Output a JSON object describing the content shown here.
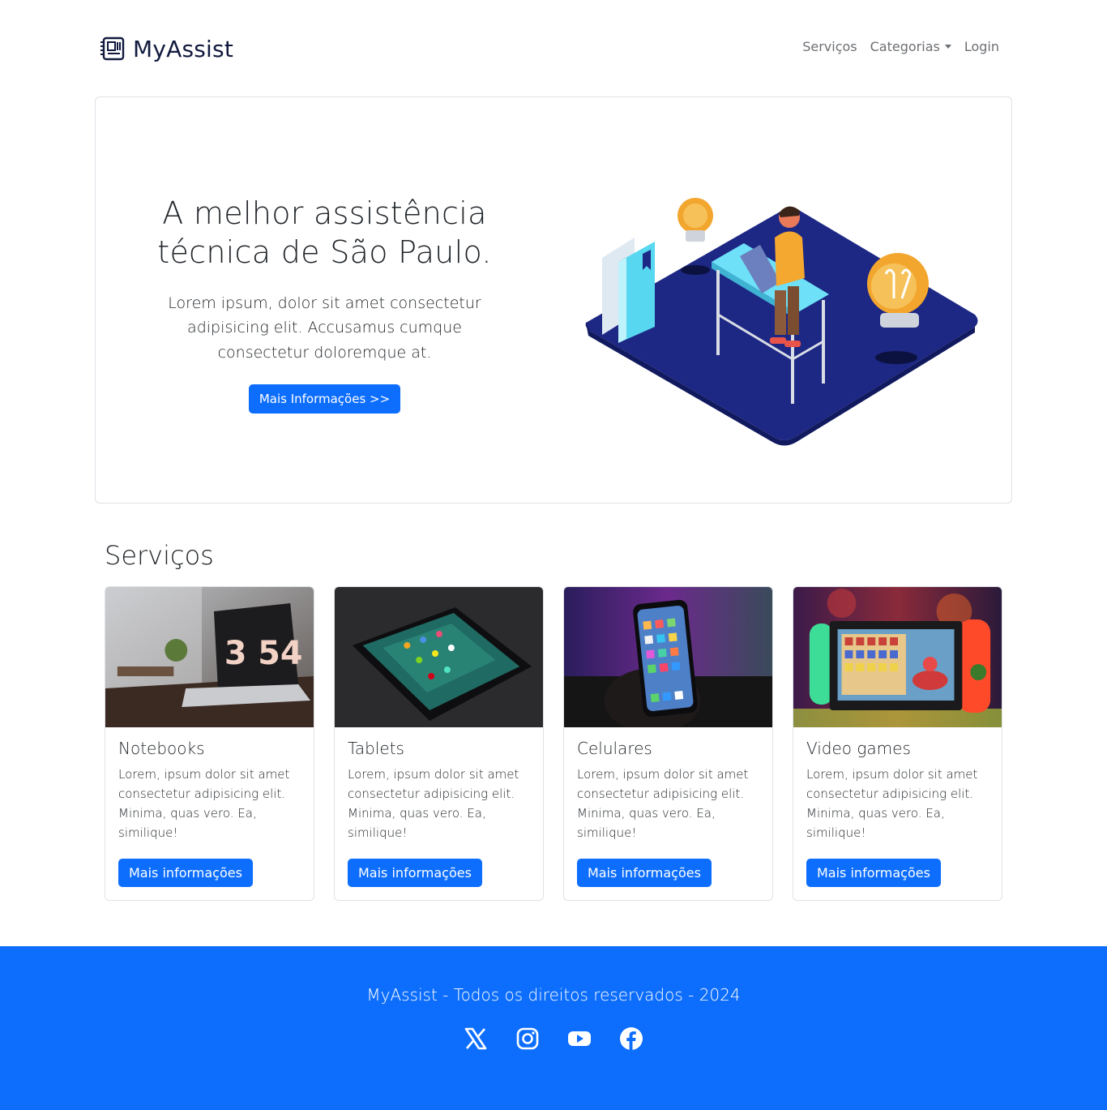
{
  "brand": {
    "name": "MyAssist",
    "icon": "motherboard-icon"
  },
  "nav": {
    "items": [
      {
        "label": "Serviços"
      },
      {
        "label": "Categorias",
        "dropdown": true
      },
      {
        "label": "Login"
      }
    ]
  },
  "hero": {
    "title": "A melhor assistência técnica de São Paulo.",
    "lead": "Lorem ipsum, dolor sit amet consectetur adipisicing elit. Accusamus cumque consectetur doloremque at.",
    "button": "Mais Informações >>"
  },
  "services": {
    "title": "Serviços",
    "cards": [
      {
        "title": "Notebooks",
        "text": "Lorem, ipsum dolor sit amet consectetur adipisicing elit. Minima, quas vero. Ea, similique!",
        "button": "Mais informações",
        "clock": "3 54"
      },
      {
        "title": "Tablets",
        "text": "Lorem, ipsum dolor sit amet consectetur adipisicing elit. Minima, quas vero. Ea, similique!",
        "button": "Mais informações"
      },
      {
        "title": "Celulares",
        "text": "Lorem, ipsum dolor sit amet consectetur adipisicing elit. Minima, quas vero. Ea, similique!",
        "button": "Mais informações"
      },
      {
        "title": "Video games",
        "text": "Lorem, ipsum dolor sit amet consectetur adipisicing elit. Minima, quas vero. Ea, similique!",
        "button": "Mais informações"
      }
    ]
  },
  "footer": {
    "text": "MyAssist - Todos os direitos reservados - 2024",
    "social": [
      "x-icon",
      "instagram-icon",
      "youtube-icon",
      "facebook-icon"
    ]
  },
  "colors": {
    "primary": "#0d6efd",
    "navy": "#111a3e",
    "border": "#dee2e6"
  }
}
